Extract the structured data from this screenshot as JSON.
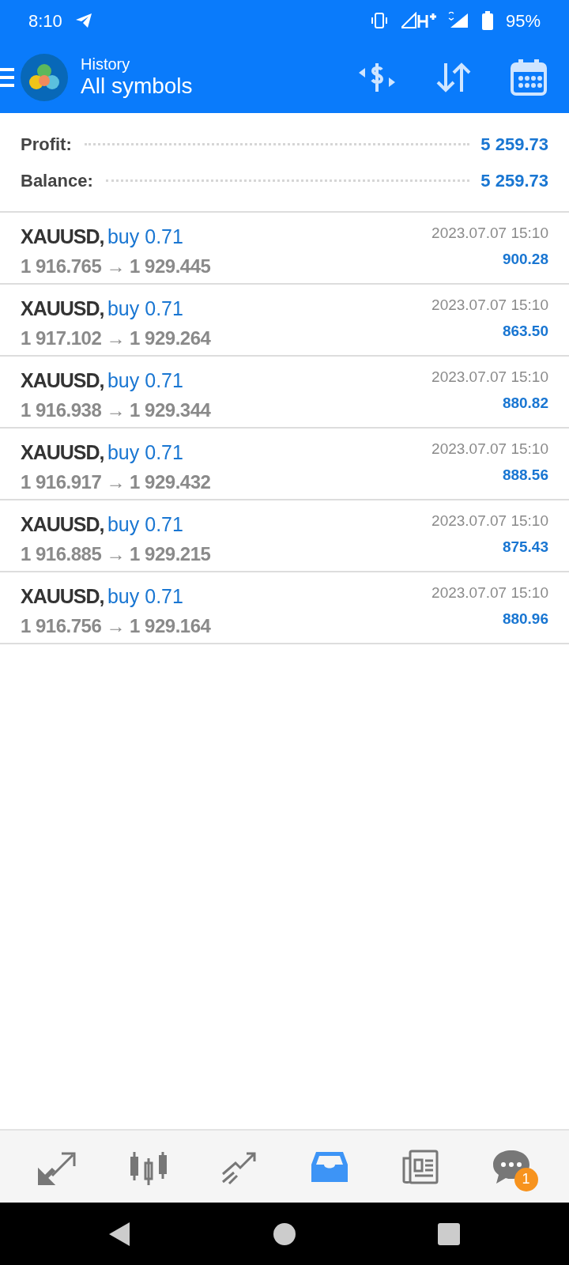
{
  "status_bar": {
    "time": "8:10",
    "battery": "95%"
  },
  "header": {
    "title": "History",
    "subtitle": "All symbols"
  },
  "summary": [
    {
      "label": "Profit:",
      "value": "5 259.73"
    },
    {
      "label": "Balance:",
      "value": "5 259.73"
    }
  ],
  "deals": [
    {
      "symbol": "XAUUSD,",
      "order": "buy 0.71",
      "prices": "1 916.765 → 1 929.445",
      "time": "2023.07.07 15:10",
      "profit": "900.28"
    },
    {
      "symbol": "XAUUSD,",
      "order": "buy 0.71",
      "prices": "1 917.102 → 1 929.264",
      "time": "2023.07.07 15:10",
      "profit": "863.50"
    },
    {
      "symbol": "XAUUSD,",
      "order": "buy 0.71",
      "prices": "1 916.938 → 1 929.344",
      "time": "2023.07.07 15:10",
      "profit": "880.82"
    },
    {
      "symbol": "XAUUSD,",
      "order": "buy 0.71",
      "prices": "1 916.917 → 1 929.432",
      "time": "2023.07.07 15:10",
      "profit": "888.56"
    },
    {
      "symbol": "XAUUSD,",
      "order": "buy 0.71",
      "prices": "1 916.885 → 1 929.215",
      "time": "2023.07.07 15:10",
      "profit": "875.43"
    },
    {
      "symbol": "XAUUSD,",
      "order": "buy 0.71",
      "prices": "1 916.756 → 1 929.164",
      "time": "2023.07.07 15:10",
      "profit": "880.96"
    }
  ],
  "bottom_nav": [
    {
      "kind": "quotes",
      "selected": false
    },
    {
      "kind": "chart",
      "selected": false
    },
    {
      "kind": "trade",
      "selected": false
    },
    {
      "kind": "history",
      "selected": true
    },
    {
      "kind": "news",
      "selected": false
    },
    {
      "kind": "chat",
      "selected": false,
      "badge": "1"
    }
  ]
}
